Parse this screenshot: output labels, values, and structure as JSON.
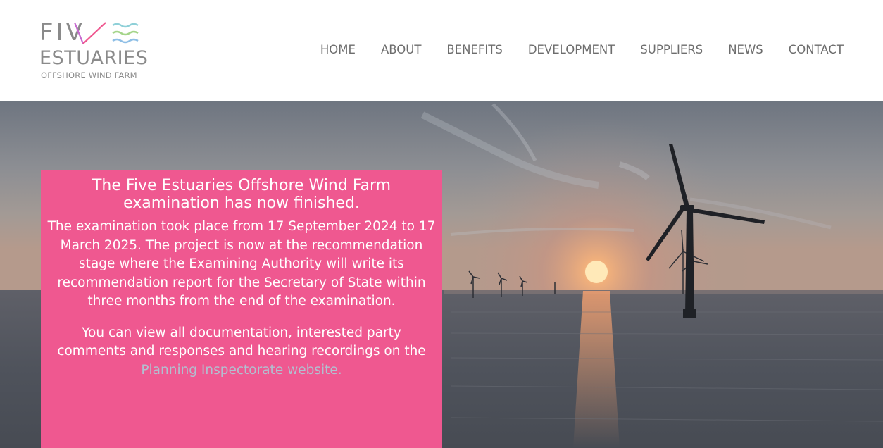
{
  "brand": {
    "word_five": "FIV",
    "word_estuaries": "ESTUARIES",
    "tagline": "OFFSHORE WIND FARM",
    "colors": {
      "grey": "#8a8a8a",
      "v_left": "#c76ad0",
      "v_right": "#ef5890",
      "wave_1": "#8fd0d8",
      "wave_2": "#a5d58a",
      "wave_3": "#8fbfe6"
    }
  },
  "nav": {
    "items": [
      {
        "label": "HOME"
      },
      {
        "label": "ABOUT"
      },
      {
        "label": "BENEFITS"
      },
      {
        "label": "DEVELOPMENT"
      },
      {
        "label": "SUPPLIERS"
      },
      {
        "label": "NEWS"
      },
      {
        "label": "CONTACT"
      }
    ]
  },
  "hero": {
    "image_subject": "offshore-wind-turbines-at-sunset",
    "notice": {
      "title": "The Five Estuaries Offshore Wind Farm examination has now finished.",
      "paragraph_1": "The examination took place from 17 September 2024 to 17 March 2025. The project is now at the recommendation stage where the Examining Authority will write its recommendation report for the Secretary of State within three months from the end of the examination.",
      "paragraph_2_prefix": "You can view all documentation, interested party comments and responses and hearing recordings on the ",
      "paragraph_2_link": "Planning Inspectorate website.",
      "background_color": "#ef5890",
      "link_color": "#b2bfd0"
    }
  }
}
